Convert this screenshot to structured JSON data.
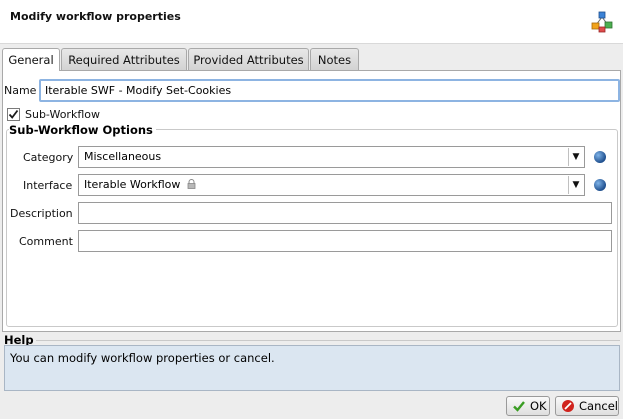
{
  "dialog": {
    "title": "Modify workflow properties",
    "app_icon": "workflow-diagram-icon"
  },
  "tabs": [
    {
      "label": "General",
      "active": true
    },
    {
      "label": "Required Attributes",
      "active": false
    },
    {
      "label": "Provided Attributes",
      "active": false
    },
    {
      "label": "Notes",
      "active": false
    }
  ],
  "general": {
    "name_label": "Name",
    "name_value": "Iterable SWF - Modify Set-Cookies",
    "subworkflow_label": "Sub-Workflow",
    "subworkflow_checked": true,
    "options_title": "Sub-Workflow Options",
    "category_label": "Category",
    "category_value": "Miscellaneous",
    "interface_label": "Interface",
    "interface_value": "Iterable Workflow",
    "description_label": "Description",
    "description_value": "",
    "comment_label": "Comment",
    "comment_value": ""
  },
  "help": {
    "title": "Help",
    "text": "You can modify workflow properties or cancel."
  },
  "buttons": {
    "ok_label": "OK",
    "cancel_label": "Cancel"
  },
  "colors": {
    "help_bg": "#dbe6f1",
    "focus_border": "#8db4e2",
    "ok_icon": "#3a9d23",
    "cancel_icon": "#d0231d"
  }
}
